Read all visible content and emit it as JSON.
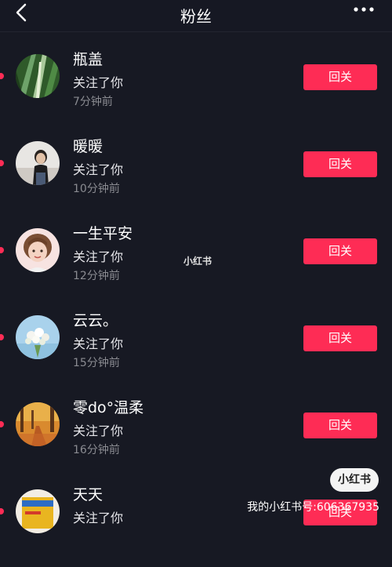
{
  "header": {
    "title": "粉丝",
    "back_icon": "chevron-left-icon",
    "more_icon": "ellipsis-icon"
  },
  "followers": [
    {
      "name": "瓶盖",
      "action": "关注了你",
      "time": "7分钟前",
      "button": "回关",
      "avatar": "plant-leaves-avatar"
    },
    {
      "name": "暖暖",
      "action": "关注了你",
      "time": "10分钟前",
      "button": "回关",
      "avatar": "girl-photo-avatar"
    },
    {
      "name": "一生平安",
      "action": "关注了你",
      "time": "12分钟前",
      "button": "回关",
      "avatar": "cartoon-girl-avatar"
    },
    {
      "name": "云云。",
      "action": "关注了你",
      "time": "15分钟前",
      "button": "回关",
      "avatar": "flower-bouquet-avatar"
    },
    {
      "name": "零do°温柔",
      "action": "关注了你",
      "time": "16分钟前",
      "button": "回关",
      "avatar": "autumn-path-avatar"
    },
    {
      "name": "天天",
      "action": "关注了你",
      "time": "",
      "button": "回关",
      "avatar": "product-box-avatar"
    }
  ],
  "watermark": {
    "center": "小红书",
    "badge": "小红书",
    "id_text": "我的小红书号:606367935"
  },
  "colors": {
    "background": "#171923",
    "accent": "#fe2c55",
    "secondary_text": "#8a8b91"
  }
}
